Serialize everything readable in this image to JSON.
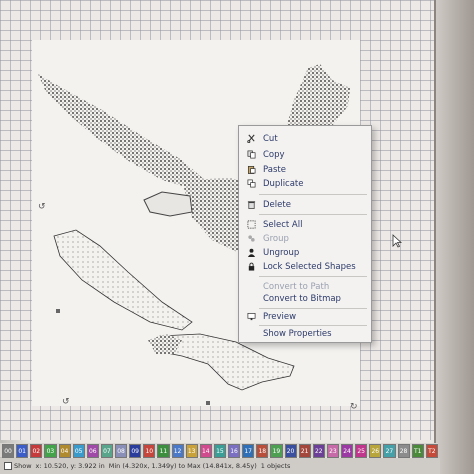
{
  "context_menu": {
    "items": [
      {
        "label": "Cut",
        "icon": "cut-icon",
        "enabled": true
      },
      {
        "label": "Copy",
        "icon": "copy-icon",
        "enabled": true
      },
      {
        "label": "Paste",
        "icon": "paste-icon",
        "enabled": true
      },
      {
        "label": "Duplicate",
        "icon": "duplicate-icon",
        "enabled": true
      },
      {
        "label": "Delete",
        "icon": "delete-icon",
        "enabled": true
      },
      {
        "label": "Select All",
        "icon": "select-all-icon",
        "enabled": true
      },
      {
        "label": "Group",
        "icon": "group-icon",
        "enabled": false
      },
      {
        "label": "Ungroup",
        "icon": "ungroup-icon",
        "enabled": true
      },
      {
        "label": "Lock Selected Shapes",
        "icon": "lock-icon",
        "enabled": true
      },
      {
        "label": "Convert to Path",
        "icon": "",
        "enabled": false
      },
      {
        "label": "Convert to Bitmap",
        "icon": "",
        "enabled": true
      },
      {
        "label": "Preview",
        "icon": "preview-icon",
        "enabled": true
      },
      {
        "label": "Show Properties",
        "icon": "",
        "enabled": true
      }
    ]
  },
  "palette": {
    "swatches": [
      {
        "label": "00",
        "color": "#7a7a7a"
      },
      {
        "label": "01",
        "color": "#3c5cc8"
      },
      {
        "label": "02",
        "color": "#c53b3b"
      },
      {
        "label": "03",
        "color": "#44a34a"
      },
      {
        "label": "04",
        "color": "#b08a2e"
      },
      {
        "label": "05",
        "color": "#3a9ac9"
      },
      {
        "label": "06",
        "color": "#a04aa8"
      },
      {
        "label": "07",
        "color": "#59a58c"
      },
      {
        "label": "08",
        "color": "#8a8fb8"
      },
      {
        "label": "09",
        "color": "#2b3e9c"
      },
      {
        "label": "10",
        "color": "#c4463c"
      },
      {
        "label": "11",
        "color": "#3d8f3f"
      },
      {
        "label": "12",
        "color": "#4a79c7"
      },
      {
        "label": "13",
        "color": "#c8a13a"
      },
      {
        "label": "14",
        "color": "#d04a8e"
      },
      {
        "label": "15",
        "color": "#3a9e96"
      },
      {
        "label": "16",
        "color": "#7a6fc0"
      },
      {
        "label": "17",
        "color": "#2f6fb8"
      },
      {
        "label": "18",
        "color": "#b94e3b"
      },
      {
        "label": "19",
        "color": "#4f9f53"
      },
      {
        "label": "20",
        "color": "#3a4f9d"
      },
      {
        "label": "21",
        "color": "#a3473d"
      },
      {
        "label": "22",
        "color": "#6b3f96"
      },
      {
        "label": "23",
        "color": "#c76aa8"
      },
      {
        "label": "24",
        "color": "#9b3aa2"
      },
      {
        "label": "25",
        "color": "#c0368c"
      },
      {
        "label": "26",
        "color": "#b8a53c"
      },
      {
        "label": "27",
        "color": "#46a0a8"
      },
      {
        "label": "28",
        "color": "#8c8c8c"
      },
      {
        "label": "T1",
        "color": "#4a8a3a"
      },
      {
        "label": "T2",
        "color": "#c64a3a"
      }
    ]
  },
  "statusbar": {
    "show_label": "Show",
    "coords": "x: 10.520, y: 3.922 in",
    "minmax": "Min (4.320x, 1.349y) to Max (14.841x, 8.45y)",
    "objects": "1 objects"
  }
}
